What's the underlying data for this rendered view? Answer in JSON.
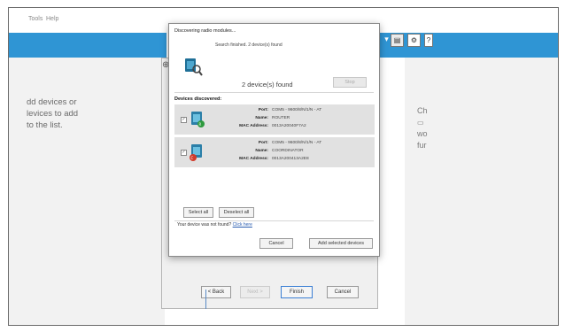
{
  "menu": {
    "tools": "Tools",
    "help": "Help"
  },
  "left_pane": {
    "line1": "dd devices or",
    "line2": "levices to add",
    "line3": "to the list."
  },
  "right_pane": {
    "line1": "Ch",
    "line2": "wo",
    "line3": "fur"
  },
  "wizard": {
    "back_label": "< Back",
    "next_label": "Next >",
    "finish_label": "Finish",
    "cancel_label": "Cancel"
  },
  "dialog": {
    "title": "Discovering radio modules...",
    "status": "Search finished. 2 device(s) found",
    "found_count": "2 device(s) found",
    "stop_label": "Stop",
    "discovered_heading": "Devices discovered:",
    "devices": [
      {
        "port_key": "Port:",
        "port": "COM5 - 9600/8/N/1/N - AT",
        "name_key": "Name:",
        "name": "ROUTER",
        "mac_key": "MAC Address:",
        "mac": "0013A20040F7A2"
      },
      {
        "port_key": "Port:",
        "port": "COM5 - 9600/8/N/1/N - AT",
        "name_key": "Name:",
        "name": "COORDINATOR",
        "mac_key": "MAC Address:",
        "mac": "0013A200413A2E8"
      }
    ],
    "select_all_label": "Select all",
    "deselect_all_label": "Deselect all",
    "not_found_text": "Your device was not found?",
    "click_here_label": "Click here",
    "cancel_label": "Cancel",
    "add_selected_label": "Add selected devices"
  },
  "colors": {
    "ribbon": "#2f95d4",
    "dialog_bg": "#ffffff",
    "device_row": "#e1e1e1",
    "link": "#2a5db0"
  }
}
